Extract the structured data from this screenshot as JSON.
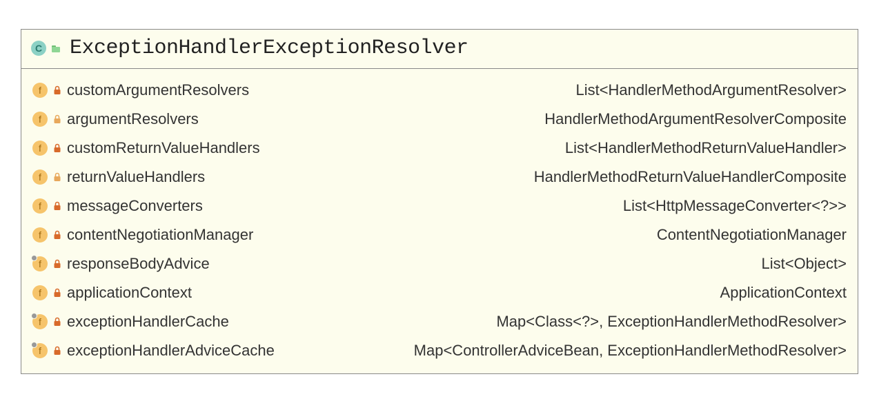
{
  "header": {
    "class_icon_letter": "C",
    "class_name": "ExceptionHandlerExceptionResolver"
  },
  "field_icon_letter": "f",
  "fields": [
    {
      "name": "customArgumentResolvers",
      "type": "List<HandlerMethodArgumentResolver>",
      "lock": "dark",
      "final": false
    },
    {
      "name": "argumentResolvers",
      "type": "HandlerMethodArgumentResolverComposite",
      "lock": "light",
      "final": false
    },
    {
      "name": "customReturnValueHandlers",
      "type": "List<HandlerMethodReturnValueHandler>",
      "lock": "dark",
      "final": false
    },
    {
      "name": "returnValueHandlers",
      "type": "HandlerMethodReturnValueHandlerComposite",
      "lock": "light",
      "final": false
    },
    {
      "name": "messageConverters",
      "type": "List<HttpMessageConverter<?>>",
      "lock": "dark",
      "final": false
    },
    {
      "name": "contentNegotiationManager",
      "type": "ContentNegotiationManager",
      "lock": "dark",
      "final": false
    },
    {
      "name": "responseBodyAdvice",
      "type": "List<Object>",
      "lock": "dark",
      "final": true
    },
    {
      "name": "applicationContext",
      "type": "ApplicationContext",
      "lock": "dark",
      "final": false
    },
    {
      "name": "exceptionHandlerCache",
      "type": "Map<Class<?>, ExceptionHandlerMethodResolver>",
      "lock": "dark",
      "final": true
    },
    {
      "name": "exceptionHandlerAdviceCache",
      "type": "Map<ControllerAdviceBean, ExceptionHandlerMethodResolver>",
      "lock": "dark",
      "final": true
    }
  ]
}
